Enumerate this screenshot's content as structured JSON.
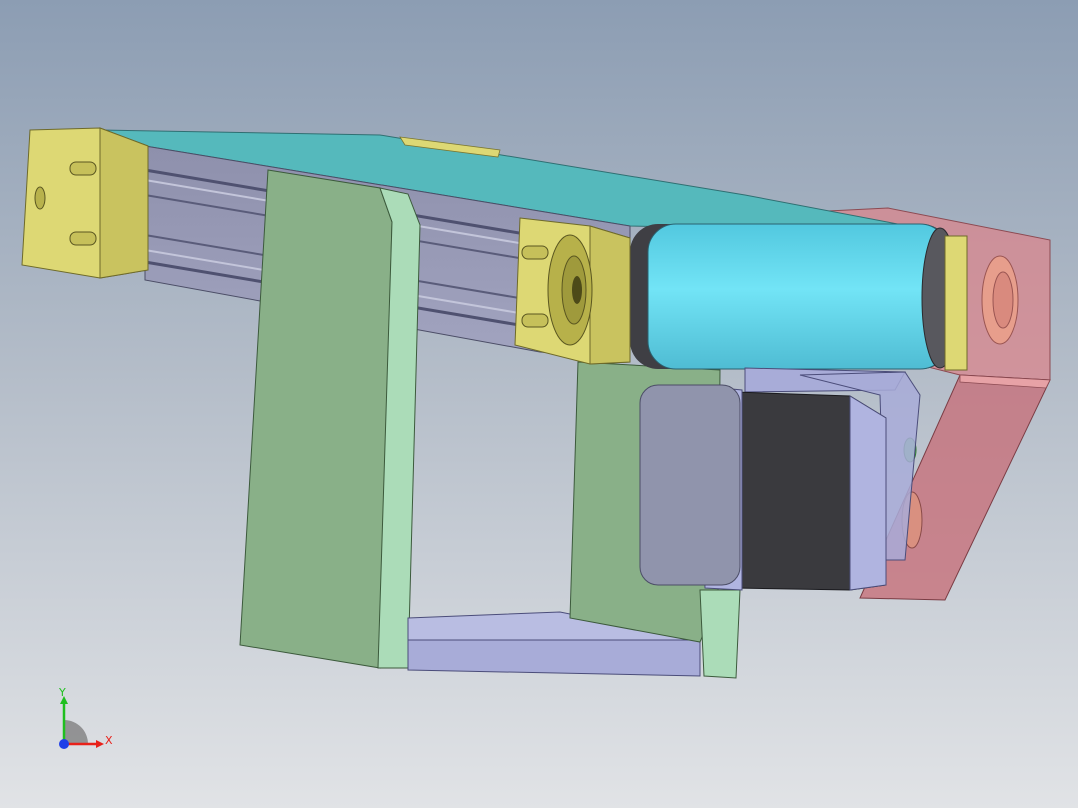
{
  "viewport": {
    "background_top": "#8c9db3",
    "background_bottom": "#e1e3e6"
  },
  "triad": {
    "x_label": "X",
    "y_label": "Y",
    "x_color": "#e8211a",
    "y_color": "#1fbf1f",
    "z_color": "#1f3fe8"
  },
  "model": {
    "parts": [
      {
        "name": "conveyor-belt",
        "color": "#55b9bc"
      },
      {
        "name": "aluminum-extrusion",
        "color": "#9b9db9"
      },
      {
        "name": "end-cap",
        "color": "#ddd874"
      },
      {
        "name": "drive-roller",
        "color": "#6fdcf0"
      },
      {
        "name": "support-bracket",
        "color": "#89b088"
      },
      {
        "name": "base-plate",
        "color": "#a8acd8"
      },
      {
        "name": "stepper-motor",
        "color": "#3a3a3e"
      },
      {
        "name": "motor-mount-transparent",
        "color": "#d9868c"
      }
    ]
  }
}
